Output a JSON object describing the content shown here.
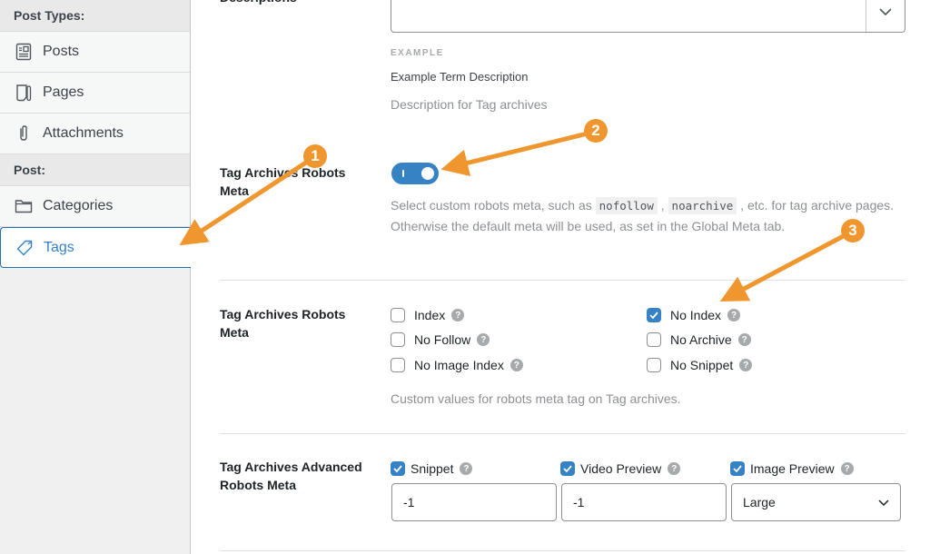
{
  "sidebar": {
    "sections": [
      {
        "header": "Post Types:",
        "items": [
          {
            "label": "Posts",
            "icon": "post-icon"
          },
          {
            "label": "Pages",
            "icon": "page-icon"
          },
          {
            "label": "Attachments",
            "icon": "paperclip-icon"
          }
        ]
      },
      {
        "header": "Post:",
        "items": [
          {
            "label": "Categories",
            "icon": "folder-icon"
          },
          {
            "label": "Tags",
            "icon": "tag-icon",
            "active": true
          }
        ]
      }
    ]
  },
  "descriptions": {
    "label": "Descriptions",
    "example_label": "EXAMPLE",
    "example_value": "Example Term Description",
    "help": "Description for Tag archives"
  },
  "robots_toggle": {
    "label": "Tag Archives Robots Meta",
    "enabled": true,
    "help_before": "Select custom robots meta, such as ",
    "code1": "nofollow",
    "help_mid": " , ",
    "code2": "noarchive",
    "help_after": " , etc. for tag archive pages. Otherwise the default meta will be used, as set in the Global Meta tab."
  },
  "robots_meta": {
    "label": "Tag Archives Robots Meta",
    "options": [
      {
        "label": "Index",
        "checked": false
      },
      {
        "label": "No Follow",
        "checked": false
      },
      {
        "label": "No Image Index",
        "checked": false
      },
      {
        "label": "No Index",
        "checked": true
      },
      {
        "label": "No Archive",
        "checked": false
      },
      {
        "label": "No Snippet",
        "checked": false
      }
    ],
    "help": "Custom values for robots meta tag on Tag archives."
  },
  "advanced": {
    "label": "Tag Archives Advanced Robots Meta",
    "snippet": {
      "label": "Snippet",
      "checked": true,
      "value": "-1"
    },
    "video_preview": {
      "label": "Video Preview",
      "checked": true,
      "value": "-1"
    },
    "image_preview": {
      "label": "Image Preview",
      "checked": true,
      "value": "Large"
    }
  },
  "annotations": [
    "1",
    "2",
    "3"
  ],
  "colors": {
    "accent": "#3582c4",
    "annotation": "#f0962f"
  }
}
